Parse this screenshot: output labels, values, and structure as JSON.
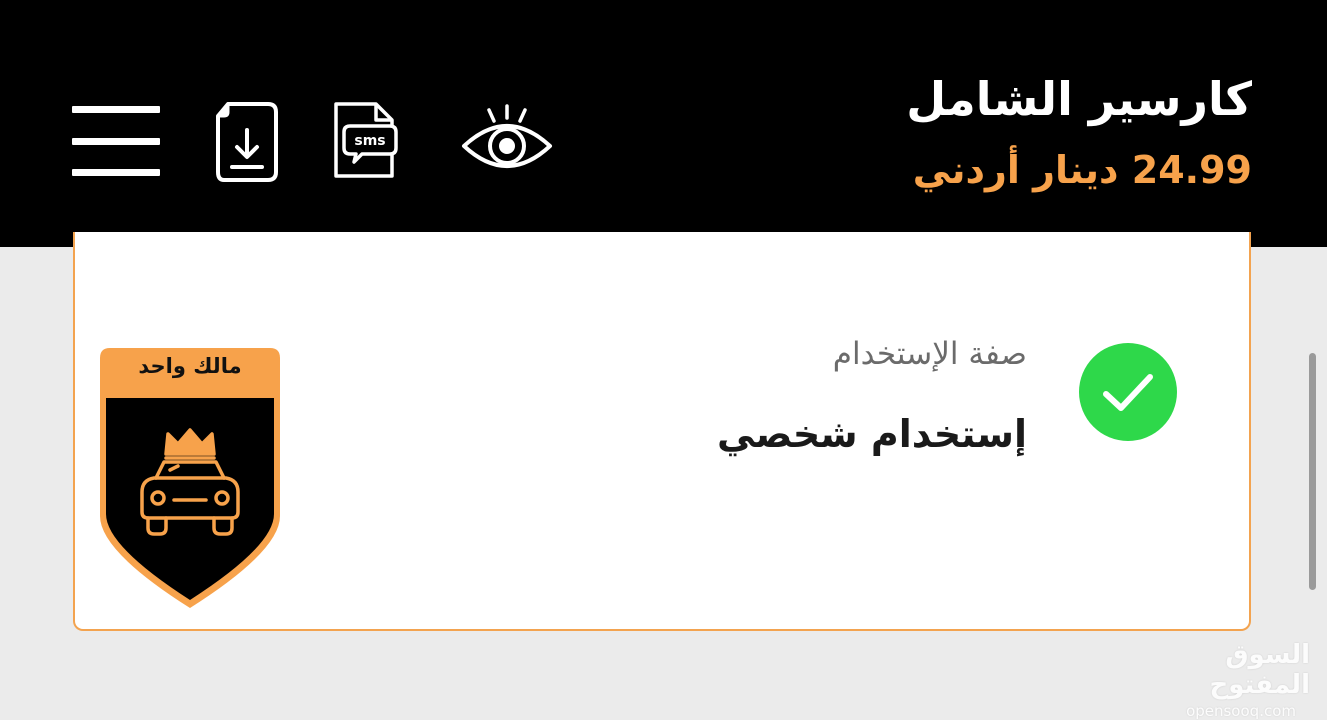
{
  "header": {
    "title": "كارسير الشامل",
    "price": "24.99 دينار أردني",
    "icons": {
      "menu": "menu-icon",
      "download": "download-document-icon",
      "sms": "sms-icon",
      "preview": "eye-icon"
    }
  },
  "usage": {
    "label": "صفة الإستخدام",
    "value": "إستخدام شخصي",
    "status_icon": "check-circle-icon"
  },
  "badge": {
    "text": "مالك واحد",
    "icon": "crowned-car-icon"
  },
  "watermark": {
    "arabic": "السوق المفتوح",
    "latin": "opensooq.com"
  },
  "colors": {
    "accent": "#f7a24b",
    "header_bg": "#000000",
    "success": "#2ed84a",
    "card_border": "#f3a34f",
    "page_bg": "#ebebeb"
  }
}
